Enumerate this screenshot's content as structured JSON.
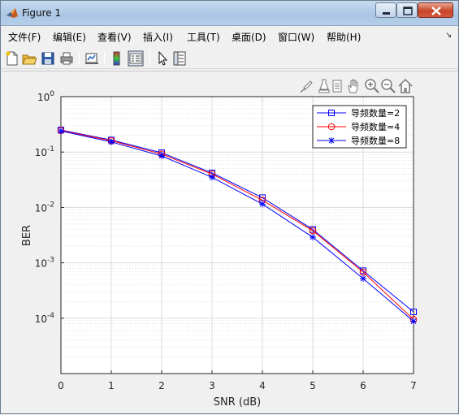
{
  "window": {
    "title": "Figure 1"
  },
  "menu": {
    "items": [
      {
        "label": "文件(F)"
      },
      {
        "label": "编辑(E)"
      },
      {
        "label": "查看(V)"
      },
      {
        "label": "插入(I)"
      },
      {
        "label": "工具(T)"
      },
      {
        "label": "桌面(D)"
      },
      {
        "label": "窗口(W)"
      },
      {
        "label": "帮助(H)"
      }
    ]
  },
  "toolbar": {
    "icons": [
      "new-figure-icon",
      "open-file-icon",
      "save-icon",
      "print-icon",
      "link-plot-icon",
      "insert-colorbar-icon",
      "insert-legend-icon",
      "edit-plot-icon",
      "property-inspector-icon"
    ]
  },
  "axes_toolbar": {
    "icons": [
      "brush-icon",
      "data-tips-icon",
      "rotate-icon",
      "pan-icon",
      "zoom-in-icon",
      "zoom-out-icon",
      "home-icon"
    ]
  },
  "colors": {
    "series1": "#0000ff",
    "series2": "#ff0000",
    "series3": "#0000ff"
  },
  "chart_data": {
    "type": "line",
    "xlabel": "SNR (dB)",
    "ylabel": "BER",
    "xlim": [
      0,
      7
    ],
    "ylim": [
      1e-05,
      1
    ],
    "yscale": "log",
    "xticks": [
      "0",
      "1",
      "2",
      "3",
      "4",
      "5",
      "6",
      "7"
    ],
    "yticks": [
      {
        "value": 1,
        "base": "10",
        "exp": "0"
      },
      {
        "value": 0.1,
        "base": "10",
        "exp": "-1"
      },
      {
        "value": 0.01,
        "base": "10",
        "exp": "-2"
      },
      {
        "value": 0.001,
        "base": "10",
        "exp": "-3"
      },
      {
        "value": 0.0001,
        "base": "10",
        "exp": "-4"
      }
    ],
    "grid": true,
    "minor_grid": true,
    "legend_position": "top-right",
    "x": [
      0,
      1,
      2,
      3,
      4,
      5,
      6,
      7
    ],
    "series": [
      {
        "name": "导频数量=2",
        "marker": "square",
        "color": "#0000ff",
        "values": [
          0.25,
          0.165,
          0.097,
          0.042,
          0.015,
          0.004,
          0.00072,
          0.00013
        ]
      },
      {
        "name": "导频数量=4",
        "marker": "circle",
        "color": "#ff0000",
        "values": [
          0.245,
          0.16,
          0.092,
          0.04,
          0.0135,
          0.0038,
          0.00068,
          9.5e-05
        ]
      },
      {
        "name": "导频数量=8",
        "marker": "star",
        "color": "#0000ff",
        "values": [
          0.24,
          0.152,
          0.085,
          0.035,
          0.0115,
          0.0029,
          0.00052,
          8.8e-05
        ]
      }
    ]
  }
}
